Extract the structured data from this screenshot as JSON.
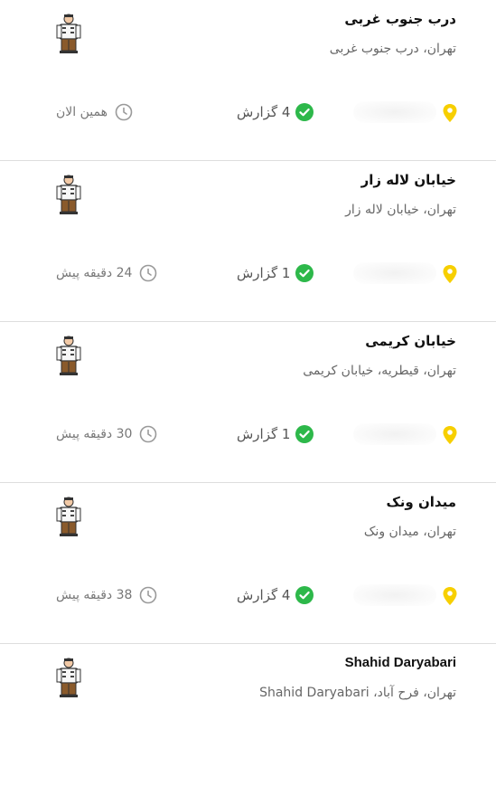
{
  "items": [
    {
      "title": "درب جنوب غربی",
      "address": "تهران، درب جنوب غربی",
      "reports": "4 گزارش",
      "time": "همین الان",
      "avatar_icon": "janitor-avatar-icon",
      "check_icon": "check-circle-icon",
      "clock_icon": "clock-icon",
      "pin_icon": "location-pin-icon"
    },
    {
      "title": "خیابان لاله زار",
      "address": "تهران، خیابان لاله زار",
      "reports": "1 گزارش",
      "time": "24 دقیقه پیش",
      "avatar_icon": "janitor-avatar-icon",
      "check_icon": "check-circle-icon",
      "clock_icon": "clock-icon",
      "pin_icon": "location-pin-icon"
    },
    {
      "title": "خیابان کریمی",
      "address": "تهران، قیطریه، خیابان کریمی",
      "reports": "1 گزارش",
      "time": "30 دقیقه پیش",
      "avatar_icon": "janitor-avatar-icon",
      "check_icon": "check-circle-icon",
      "clock_icon": "clock-icon",
      "pin_icon": "location-pin-icon"
    },
    {
      "title": "میدان ونک",
      "address": "تهران، میدان ونک",
      "reports": "4 گزارش",
      "time": "38 دقیقه پیش",
      "avatar_icon": "janitor-avatar-icon",
      "check_icon": "check-circle-icon",
      "clock_icon": "clock-icon",
      "pin_icon": "location-pin-icon"
    },
    {
      "title": "Shahid Daryabari",
      "address": "تهران، فرح آباد، Shahid Daryabari",
      "avatar_icon": "janitor-avatar-icon"
    }
  ],
  "colors": {
    "check": "#2db84a",
    "pin": "#f7cf00",
    "clock": "#9a9a9a",
    "divider": "#dedede"
  }
}
